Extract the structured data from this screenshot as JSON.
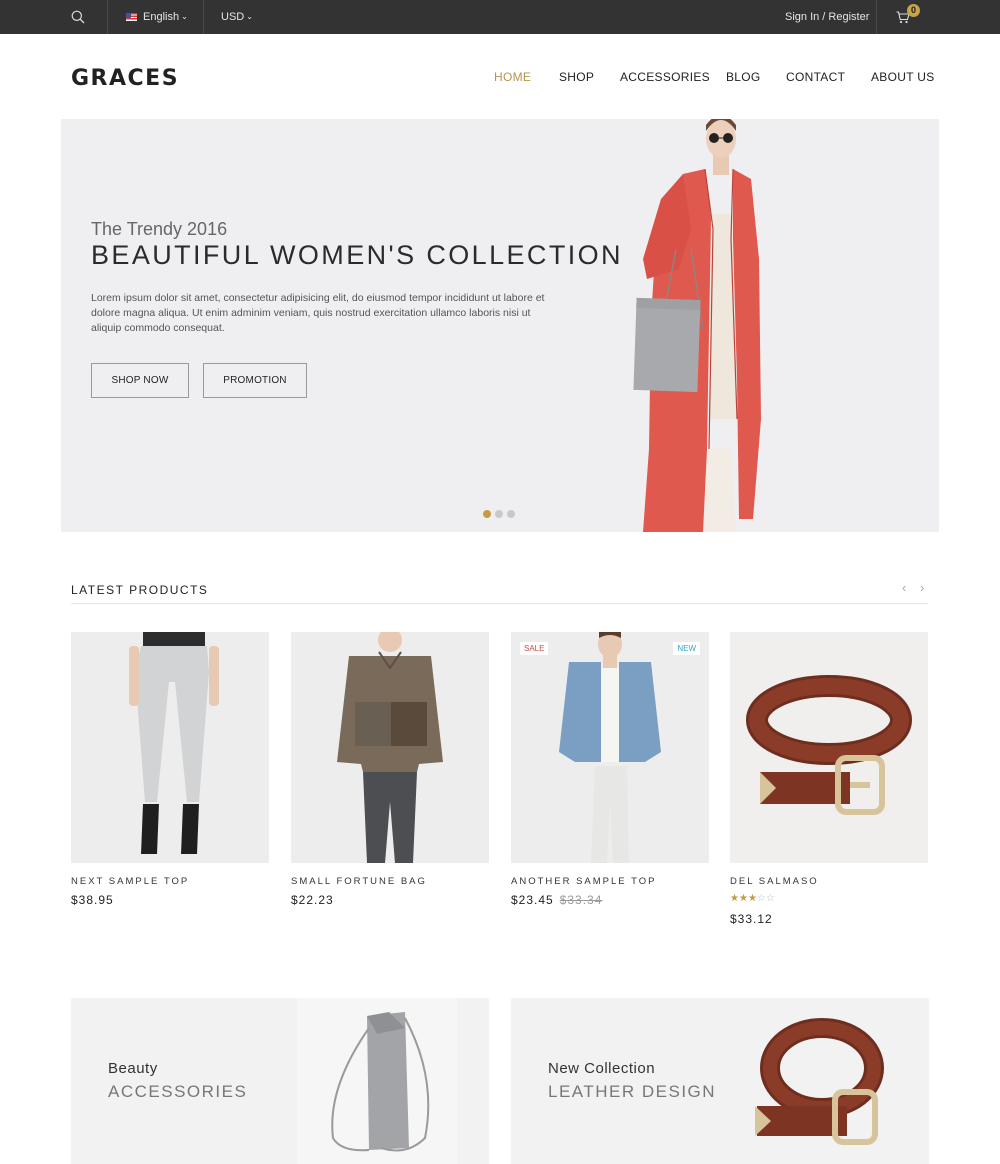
{
  "topbar": {
    "language": "English",
    "currency": "USD",
    "account_links": "Sign In / Register",
    "cart_count": "0"
  },
  "header": {
    "logo": "GRACES",
    "nav": [
      "HOME",
      "SHOP",
      "ACCESSORIES",
      "BLOG",
      "CONTACT",
      "ABOUT US"
    ],
    "active_nav": "HOME"
  },
  "hero": {
    "subtitle": "The Trendy 2016",
    "title": "BEAUTIFUL WOMEN'S COLLECTION",
    "text": "Lorem ipsum dolor sit amet, consectetur adipisicing elit, do eiusmod tempor incididunt ut labore et dolore magna aliqua. Ut enim adminim veniam, quis nostrud exercitation ullamco laboris nisi ut aliquip commodo consequat.",
    "primary_button": "SHOP NOW",
    "secondary_button": "PROMOTION",
    "slide_count": 3,
    "active_slide": 1
  },
  "latest": {
    "title": "LATEST PRODUCTS",
    "products": [
      {
        "name": "NEXT SAMPLE TOP",
        "price": "$38.95"
      },
      {
        "name": "SMALL FORTUNE BAG",
        "price": "$22.23"
      },
      {
        "name": "ANOTHER SAMPLE TOP",
        "price": "$23.45",
        "old_price": "$33.34",
        "badge_left": "SALE",
        "badge_right": "NEW"
      },
      {
        "name": "DEL SALMASO",
        "price": "$33.12",
        "rating": 3,
        "rating_max": 5
      }
    ]
  },
  "banners": [
    {
      "subtitle": "Beauty",
      "title": "ACCESSORIES"
    },
    {
      "subtitle": "New Collection",
      "title": "LEATHER DESIGN"
    }
  ],
  "colors": {
    "accent": "#c59a45",
    "topbar": "#333333",
    "hero_bg": "#efeff1",
    "coat": "#e0594e"
  },
  "icons": [
    "search-icon",
    "flag-us-icon",
    "chevron-down-icon",
    "cart-icon",
    "chevron-left-icon",
    "chevron-right-icon",
    "star-icon"
  ]
}
